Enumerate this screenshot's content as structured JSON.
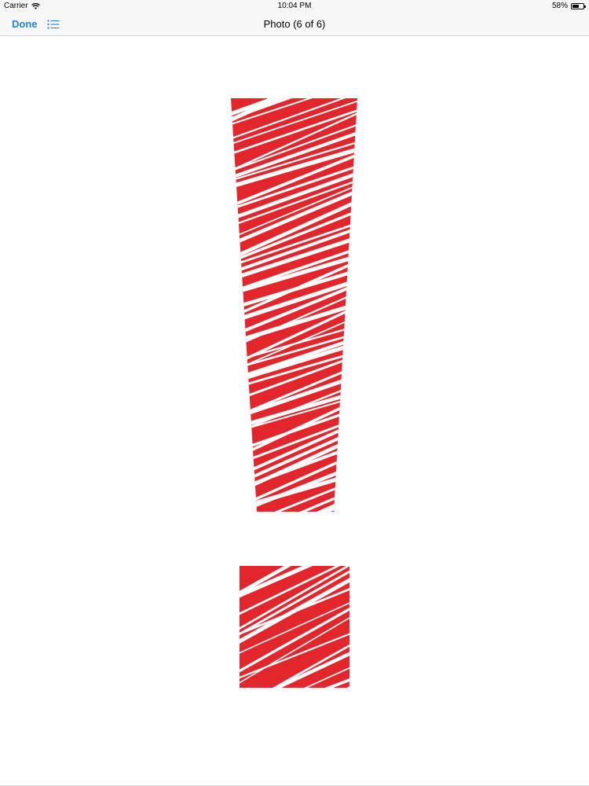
{
  "status_bar": {
    "carrier": "Carrier",
    "time": "10:04 PM",
    "battery_percent": "58%",
    "battery_level": 0.58,
    "wifi_icon": "wifi-icon",
    "battery_icon": "battery-icon"
  },
  "nav": {
    "done_label": "Done",
    "list_icon": "list-icon",
    "title": "Photo (6 of 6)"
  },
  "photo": {
    "subject": "exclamation-mark",
    "color": "#e3262b",
    "background": "#ffffff"
  }
}
